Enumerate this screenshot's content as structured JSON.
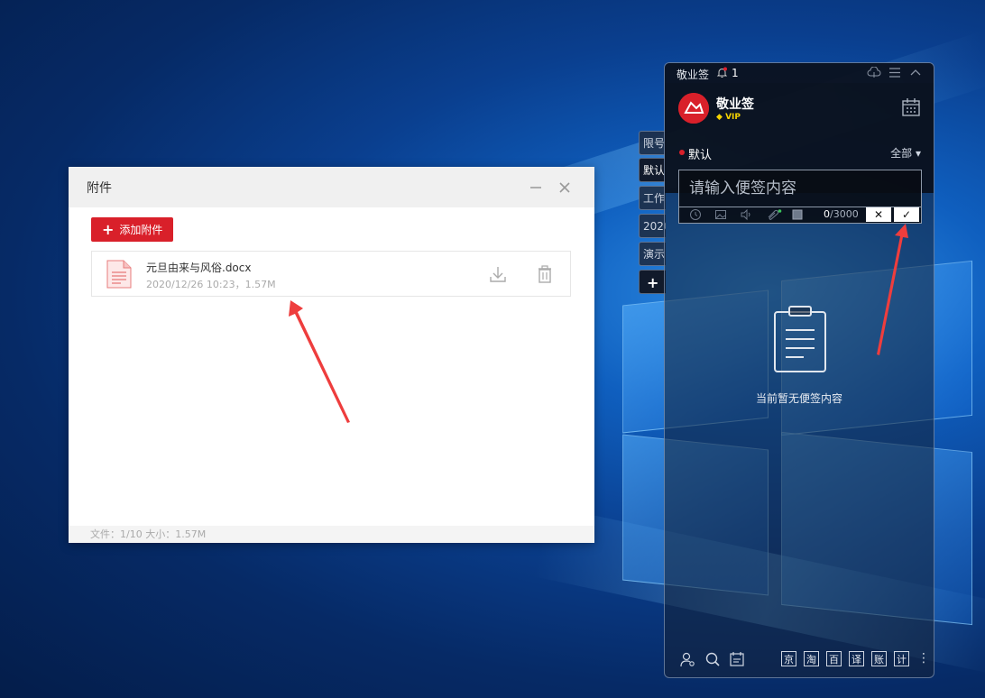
{
  "dialog": {
    "title": "附件",
    "add_button": "添加附件",
    "file": {
      "name": "元旦由来与风俗.docx",
      "meta": "2020/12/26 10:23，1.57M"
    },
    "footer": "文件：1/10    大小：1.57M"
  },
  "side_tabs": [
    "限号",
    "默认",
    "工作",
    "2020",
    "演示",
    "+"
  ],
  "note": {
    "app_name": "敬业签",
    "notification_count": "1",
    "brand": "敬业签",
    "vip": "VIP",
    "category": "默认",
    "filter": "全部 ▾",
    "input_placeholder": "请输入便签内容",
    "counter_current": "0",
    "counter_max": "/3000",
    "cancel": "✕",
    "confirm": "✓",
    "empty_text": "当前暂无便签内容",
    "quick_buttons": [
      "京",
      "淘",
      "百",
      "译",
      "账",
      "计"
    ],
    "colors": {
      "accent": "#d9202a",
      "vip": "#f5d300"
    }
  }
}
